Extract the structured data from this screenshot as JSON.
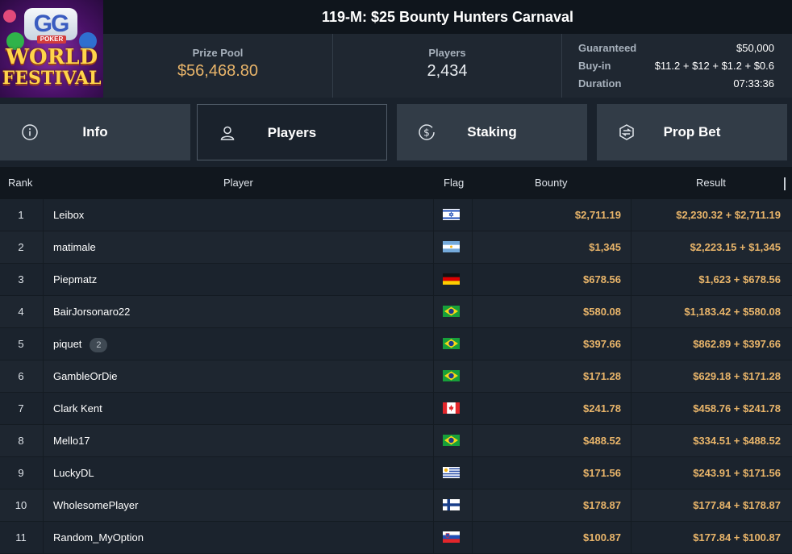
{
  "header": {
    "title": "119-M: $25 Bounty Hunters Carnaval",
    "logo": {
      "top": "GG",
      "sub": "POKER",
      "line1": "WORLD",
      "line2": "FESTIVAL"
    },
    "prize_pool": {
      "label": "Prize Pool",
      "value": "$56,468.80"
    },
    "players": {
      "label": "Players",
      "value": "2,434"
    },
    "details": [
      {
        "key": "Guaranteed",
        "value": "$50,000"
      },
      {
        "key": "Buy-in",
        "value": "$11.2 + $12 + $1.2 + $0.6"
      },
      {
        "key": "Duration",
        "value": "07:33:36"
      }
    ]
  },
  "tabs": [
    {
      "label": "Info",
      "icon": "info-icon",
      "active": false
    },
    {
      "label": "Players",
      "icon": "user-icon",
      "active": true
    },
    {
      "label": "Staking",
      "icon": "dollar-coin-icon",
      "active": false
    },
    {
      "label": "Prop Bet",
      "icon": "prop-bet-icon",
      "active": false
    }
  ],
  "table": {
    "columns": {
      "rank": "Rank",
      "player": "Player",
      "flag": "Flag",
      "bounty": "Bounty",
      "result": "Result"
    },
    "rows": [
      {
        "rank": "1",
        "player": "Leibox",
        "flag": "israel",
        "bounty": "$2,711.19",
        "result": "$2,230.32 + $2,711.19"
      },
      {
        "rank": "2",
        "player": "matimale",
        "flag": "argentina",
        "bounty": "$1,345",
        "result": "$2,223.15 + $1,345"
      },
      {
        "rank": "3",
        "player": "Piepmatz",
        "flag": "germany",
        "bounty": "$678.56",
        "result": "$1,623 + $678.56"
      },
      {
        "rank": "4",
        "player": "BairJorsonaro22",
        "flag": "brazil",
        "bounty": "$580.08",
        "result": "$1,183.42 + $580.08"
      },
      {
        "rank": "5",
        "player": "piquet",
        "badge": "2",
        "flag": "brazil",
        "bounty": "$397.66",
        "result": "$862.89 + $397.66"
      },
      {
        "rank": "6",
        "player": "GambleOrDie",
        "flag": "brazil",
        "bounty": "$171.28",
        "result": "$629.18 + $171.28"
      },
      {
        "rank": "7",
        "player": "Clark Kent",
        "flag": "canada",
        "bounty": "$241.78",
        "result": "$458.76 + $241.78"
      },
      {
        "rank": "8",
        "player": "Mello17",
        "flag": "brazil",
        "bounty": "$488.52",
        "result": "$334.51 + $488.52"
      },
      {
        "rank": "9",
        "player": "LuckyDL",
        "flag": "uruguay",
        "bounty": "$171.56",
        "result": "$243.91 + $171.56"
      },
      {
        "rank": "10",
        "player": "WholesomePlayer",
        "flag": "finland",
        "bounty": "$178.87",
        "result": "$177.84 + $178.87"
      },
      {
        "rank": "11",
        "player": "Random_MyOption",
        "flag": "slovenia",
        "bounty": "$100.87",
        "result": "$177.84 + $100.87"
      }
    ]
  },
  "colors": {
    "accent_gold": "#e9b56a",
    "background": "#1a222c",
    "tab_bg": "#323c47"
  }
}
